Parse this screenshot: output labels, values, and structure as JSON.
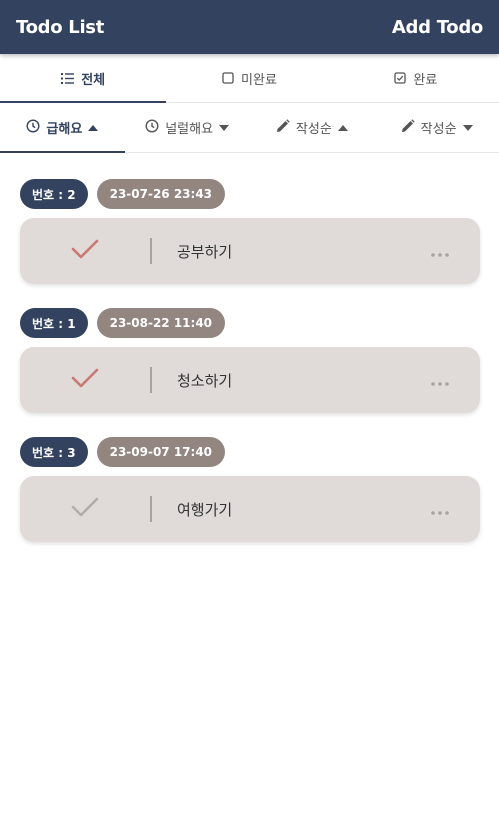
{
  "header": {
    "title": "Todo List",
    "add_label": "Add Todo"
  },
  "tabs": [
    {
      "label": "전체",
      "icon": "list-icon"
    },
    {
      "label": "미완료",
      "icon": "checkbox-empty-icon"
    },
    {
      "label": "완료",
      "icon": "checkbox-checked-icon"
    }
  ],
  "sorts": [
    {
      "label": "급해요",
      "icon": "clock-icon",
      "arrow": "up"
    },
    {
      "label": "널럴해요",
      "icon": "clock-icon",
      "arrow": "down"
    },
    {
      "label": "작성순",
      "icon": "pencil-icon",
      "arrow": "up"
    },
    {
      "label": "작성순",
      "icon": "pencil-icon",
      "arrow": "down"
    }
  ],
  "todos": [
    {
      "num_label": "번호 : 2",
      "date": "23-07-26 23:43",
      "text": "공부하기",
      "done": true
    },
    {
      "num_label": "번호 : 1",
      "date": "23-08-22 11:40",
      "text": "청소하기",
      "done": true
    },
    {
      "num_label": "번호 : 3",
      "date": "23-09-07 17:40",
      "text": "여행가기",
      "done": false
    }
  ],
  "colors": {
    "primary": "#33425f",
    "date_badge": "#938680",
    "card": "#e0dbd9",
    "check_done": "#c97a72",
    "check_todo": "#b3adab"
  }
}
